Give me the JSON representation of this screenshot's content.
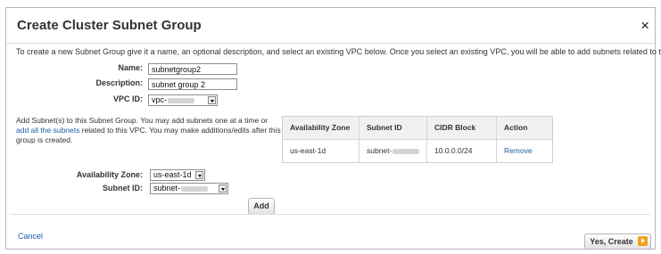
{
  "dialog": {
    "title": "Create Cluster Subnet Group",
    "close_glyph": "×",
    "intro": "To create a new Subnet Group give it a name, an optional description, and select an existing VPC below. Once you select an existing VPC, you will be able to add subnets related to that VPC."
  },
  "form": {
    "name_label": "Name:",
    "name_value": "subnetgroup2",
    "description_label": "Description:",
    "description_value": "subnet group 2",
    "vpc_label": "VPC ID:",
    "vpc_value": "vpc-"
  },
  "add_subnets": {
    "text_before": "Add Subnet(s) to this Subnet Group. You may add subnets one at a time or",
    "link": "add all the subnets",
    "text_after": "related to this VPC. You may make additions/edits after this group is created.",
    "az_label": "Availability Zone:",
    "az_value": "us-east-1d",
    "subnet_label": "Subnet ID:",
    "subnet_value": "subnet-",
    "add_button": "Add"
  },
  "subnet_table": {
    "columns": [
      "Availability Zone",
      "Subnet ID",
      "CIDR Block",
      "Action"
    ],
    "rows": [
      {
        "availability_zone": "us-east-1d",
        "subnet_id": "subnet-",
        "cidr_block": "10.0.0.0/24",
        "action": "Remove"
      }
    ]
  },
  "footer": {
    "cancel": "Cancel",
    "yes_create": "Yes, Create"
  },
  "colors": {
    "link": "#1f5fa8",
    "accent_orange": "#f0a21c"
  },
  "icons": {
    "close": "close-icon",
    "dropdown": "chevron-down-icon",
    "confirm": "arrow-right-icon"
  }
}
